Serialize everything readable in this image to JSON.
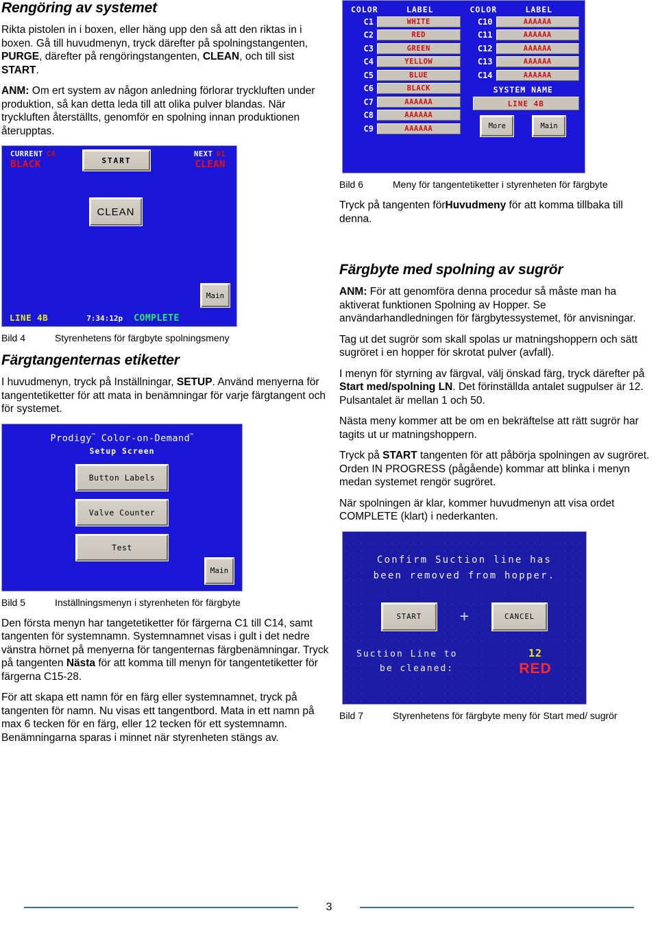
{
  "left": {
    "heading": "Rengöring av systemet",
    "para1_parts": [
      {
        "t": "Rikta pistolen in i boxen, eller häng upp den så att den riktas in i boxen.  Gå till huvudmenyn, tryck därefter på spolningstangenten, ",
        "b": false
      },
      {
        "t": "PURGE",
        "b": true
      },
      {
        "t": ", därefter på rengöringstangenten, ",
        "b": false
      },
      {
        "t": "CLEAN",
        "b": true
      },
      {
        "t": ", och till sist ",
        "b": false
      },
      {
        "t": "START",
        "b": true
      },
      {
        "t": ".",
        "b": false
      }
    ],
    "para2_parts": [
      {
        "t": "ANM:",
        "b": true
      },
      {
        "t": "  Om ert system av någon anledning förlorar tryckluften under produktion, så kan detta leda till att olika pulver blandas.  När tryckluften återställts, genomför en spolning innan produktionen återupptas.",
        "b": false
      }
    ],
    "bild4_caption_id": "Bild 4",
    "bild4_caption_text": "Styrenhetens för färgbyte spolningsmeny",
    "heading2": "Färgtangenternas etiketter",
    "para3_parts": [
      {
        "t": "I huvudmenyn, tryck på Inställningar, ",
        "b": false
      },
      {
        "t": "SETUP",
        "b": true
      },
      {
        "t": ".  Använd menyerna för tangentetiketter för att mata in benämningar för varje färgtangent och för systemet.",
        "b": false
      }
    ],
    "bild5_caption_id": "Bild 5",
    "bild5_caption_text": "Inställningsmenyn i styrenheten för färgbyte",
    "para4_parts": [
      {
        "t": "Den första menyn har tangetetiketter för färgerna C1 till C14, samt tangenten för systemnamn. Systemnamnet visas i gult i det nedre vänstra hörnet på menyerna för tangenternas färgbenämningar. Tryck på tangenten ",
        "b": false
      },
      {
        "t": "Nästa",
        "b": true
      },
      {
        "t": " för att komma till menyn för tangentetiketter för färgerna C15-28.",
        "b": false
      }
    ],
    "para5_parts": [
      {
        "t": "För att skapa ett namn för en färg eller systemnamnet, tryck på tangenten för namn.  Nu visas ett tangentbord.  Mata in ett namn på max 6 tecken för en färg, eller 12 tecken för ett systemnamn. Benämningarna sparas i minnet när styrenheten stängs av.",
        "b": false
      }
    ]
  },
  "right": {
    "bild6_caption_id": "Bild 6",
    "bild6_caption_text": "Meny för tangentetiketter i styrenheten för färgbyte",
    "para1_parts": [
      {
        "t": "Tryck på tangenten för",
        "b": false
      },
      {
        "t": "Huvudmeny",
        "b": true
      },
      {
        "t": " för att komma tillbaka till denna.",
        "b": false
      }
    ],
    "heading": "Färgbyte med spolning av sugrör",
    "para2_parts": [
      {
        "t": "ANM:",
        "b": true
      },
      {
        "t": "  För att genomföra denna procedur så måste man ha aktiverat funktionen Spolning av Hopper.  Se användarhandledningen för färgbytessystemet, för anvisningar.",
        "b": false
      }
    ],
    "para3_parts": [
      {
        "t": "Tag ut det sugrör som skall spolas ur matningshoppern och sätt sugröret i en hopper för skrotat pulver (avfall).",
        "b": false
      }
    ],
    "para4_parts": [
      {
        "t": "I menyn för styrning av färgval, välj önskad färg, tryck därefter på ",
        "b": false
      },
      {
        "t": "Start med/spolning LN",
        "b": true
      },
      {
        "t": ".  Det förinställda antalet sugpulser är 12. Pulsantalet är mellan 1 och 50.",
        "b": false
      }
    ],
    "para5_parts": [
      {
        "t": "Nästa meny kommer att be om en bekräftelse att rätt sugrör har tagits ut ur matningshoppern.",
        "b": false
      }
    ],
    "para6_parts": [
      {
        "t": "Tryck på ",
        "b": false
      },
      {
        "t": "START",
        "b": true
      },
      {
        "t": " tangenten för att påbörja spolningen av sugröret.  Orden IN PROGRESS  (pågående) kommar att blinka i menyn medan systemet rengör sugröret.",
        "b": false
      }
    ],
    "para7_parts": [
      {
        "t": "När spolningen är klar, kommer huvudmenyn att visa ordet COMPLETE (klart) i nederkanten.",
        "b": false
      }
    ],
    "bild7_caption_id": "Bild 7",
    "bild7_caption_text": "Styrenhetens för färgbyte meny för Start med/ sugrör"
  },
  "bild6_screen": {
    "header_color": "COLOR",
    "header_label": "LABEL",
    "left_rows": [
      {
        "id": "C1",
        "label": "WHITE"
      },
      {
        "id": "C2",
        "label": "RED"
      },
      {
        "id": "C3",
        "label": "GREEN"
      },
      {
        "id": "C4",
        "label": "YELLOW"
      },
      {
        "id": "C5",
        "label": "BLUE"
      },
      {
        "id": "C6",
        "label": "BLACK"
      },
      {
        "id": "C7",
        "label": "AAAAAA"
      },
      {
        "id": "C8",
        "label": "AAAAAA"
      },
      {
        "id": "C9",
        "label": "AAAAAA"
      }
    ],
    "right_rows": [
      {
        "id": "C10",
        "label": "AAAAAA"
      },
      {
        "id": "C11",
        "label": "AAAAAA"
      },
      {
        "id": "C12",
        "label": "AAAAAA"
      },
      {
        "id": "C13",
        "label": "AAAAAA"
      },
      {
        "id": "C14",
        "label": "AAAAAA"
      }
    ],
    "system_name_header": "SYSTEM NAME",
    "system_name_value": "LINE 4B",
    "btn_more": "More",
    "btn_main": "Main",
    "bg_color": "#1A18D6",
    "label_text_color": "#cc1111"
  },
  "bild4_screen": {
    "current_header": "CURRENT",
    "current_num": "C6",
    "current_value": "BLACK",
    "next_header": "NEXT",
    "next_num": "01",
    "next_value": "CLEAN",
    "btn_start": "START",
    "btn_clean": "CLEAN",
    "btn_main": "Main",
    "status_line": "LINE 4B",
    "status_time": "7:34:12p",
    "status_state": "COMPLETE",
    "line_color": "#e8e82a",
    "state_color": "#2ce86a"
  },
  "bild5_screen": {
    "title": "Prodigy",
    "title_tm": "™",
    "title2": " Color-on-Demand",
    "title2_tm": "™",
    "subtitle": "Setup Screen",
    "btn_button_labels": "Button Labels",
    "btn_valve_counter": "Valve Counter",
    "btn_test": "Test",
    "btn_main": "Main"
  },
  "bild7_screen": {
    "message_line1": "Confirm Suction line has",
    "message_line2": "been removed from hopper.",
    "btn_start": "START",
    "btn_cancel": "CANCEL",
    "plus_glyph": "+",
    "foot_label_line1": "Suction Line to",
    "foot_label_line2": "be cleaned:",
    "foot_number": "12",
    "foot_color": "RED",
    "number_color": "#f0f000",
    "color_color": "#ff2a2a"
  },
  "footer": {
    "page_number": "3"
  }
}
